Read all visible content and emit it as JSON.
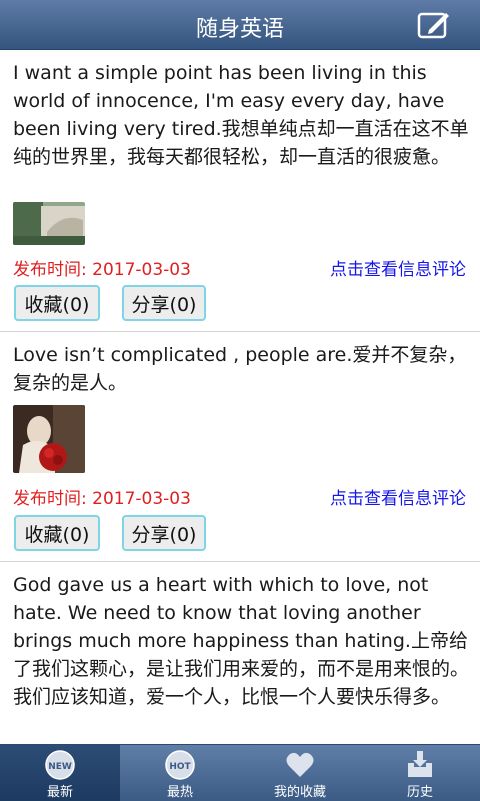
{
  "header": {
    "title": "随身英语"
  },
  "posts": [
    {
      "text": "I want a simple point has been living in this world of innocence, I'm easy every day, have been living very tired.我想单纯点却一直活在这不单纯的世界里，我每天都很轻松，却一直活的很疲惫。",
      "date": "发布时间: 2017-03-03",
      "view_link": "点击查看信息评论",
      "collect": "收藏(0)",
      "share": "分享(0)"
    },
    {
      "text": "Love isn’t complicated , people are.爱并不复杂，复杂的是人。",
      "date": "发布时间: 2017-03-03",
      "view_link": "点击查看信息评论",
      "collect": "收藏(0)",
      "share": "分享(0)"
    },
    {
      "text": "God gave us a heart with which to love, not hate. We need to know that loving another brings much more happiness than hating.上帝给了我们这颗心，是让我们用来爱的，而不是用来恨的。我们应该知道，爱一个人，比恨一个人要快乐得多。"
    }
  ],
  "tabs": [
    {
      "label": "最新",
      "badge": "NEW",
      "icon": "new-icon",
      "active": true
    },
    {
      "label": "最热",
      "badge": "HOT",
      "icon": "hot-icon",
      "active": false
    },
    {
      "label": "我的收藏",
      "icon": "heart-icon",
      "active": false
    },
    {
      "label": "历史",
      "icon": "history-icon",
      "active": false
    }
  ],
  "colors": {
    "header": "#34557f",
    "date": "#e02020",
    "link": "#1616e8",
    "button_border": "#7ed5e6"
  }
}
